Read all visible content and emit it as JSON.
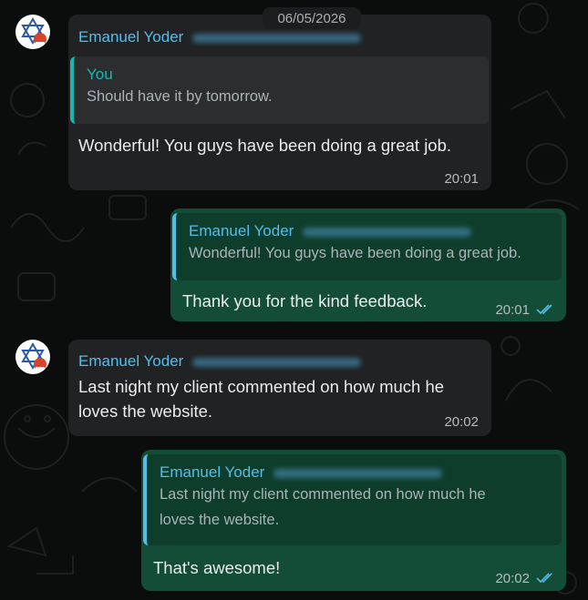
{
  "date_divider": "06/05/2026",
  "messages": [
    {
      "sender": "Emanuel Yoder",
      "reply_to": {
        "name": "You",
        "text": "Should have it by tomorrow."
      },
      "text": "Wonderful! You guys have been doing a great job.",
      "time": "20:01"
    },
    {
      "reply_to": {
        "name": "Emanuel Yoder",
        "text": "Wonderful! You guys have been doing a great job."
      },
      "text": "Thank you for the kind feedback.",
      "time": "20:01"
    },
    {
      "sender": "Emanuel Yoder",
      "text_lines": [
        "Last night my client commented on how much he",
        "loves the website."
      ],
      "time": "20:02"
    },
    {
      "reply_to": {
        "name": "Emanuel Yoder",
        "text_lines": [
          "Last night my client commented on how much he",
          "loves the website."
        ]
      },
      "text": "That's awesome!",
      "time": "20:02"
    }
  ],
  "colors": {
    "incoming_bubble": "#202223",
    "outgoing_bubble": "#134d37",
    "sender_name": "#53bdeb",
    "read_ticks": "#53bdeb",
    "quote_bar_self": "#19b6b0"
  },
  "icons": [
    "avatar-star-of-david",
    "double-check-read-icon"
  ]
}
